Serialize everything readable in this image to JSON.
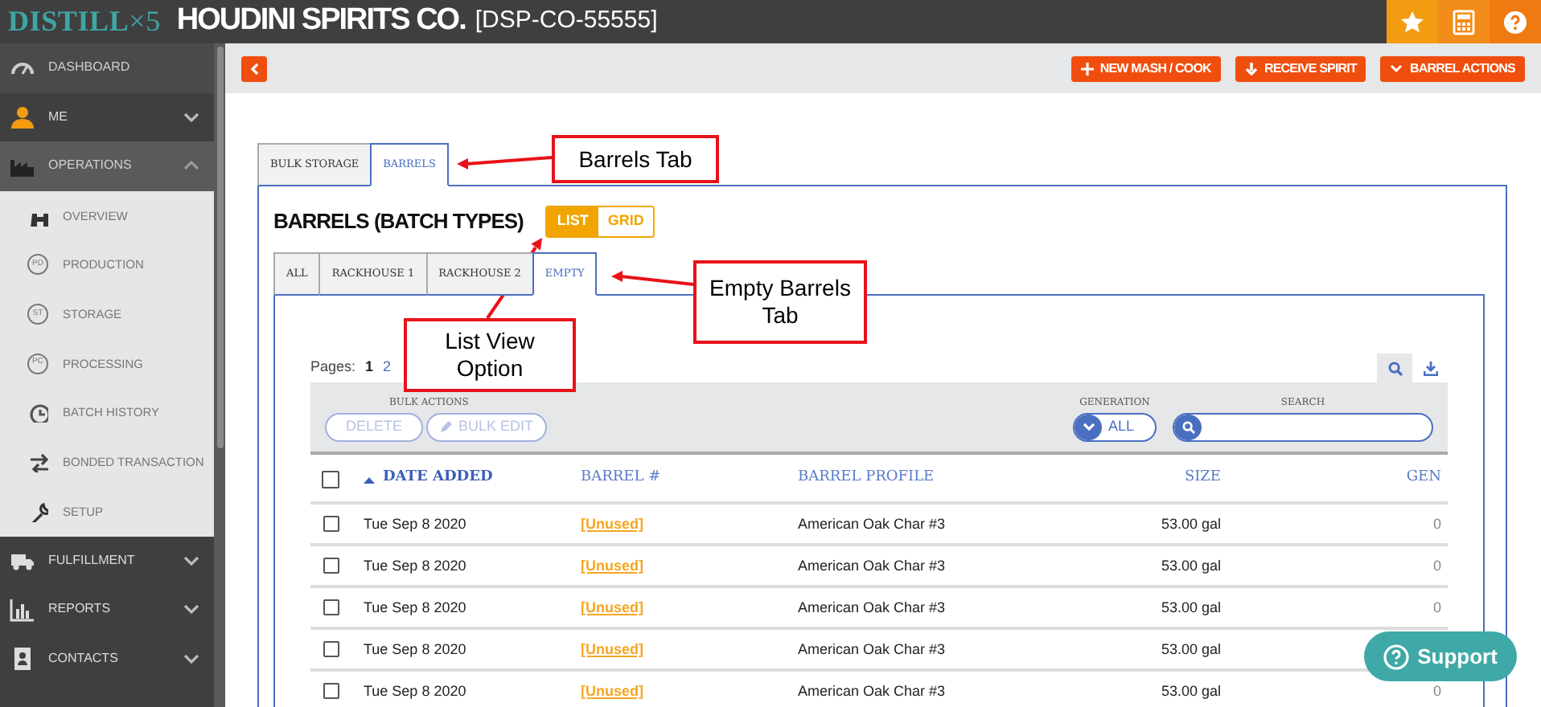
{
  "header": {
    "logo": "DISTILL",
    "logo_mark": "×5",
    "company": "HOUDINI SPIRITS CO.",
    "license": "[DSP-CO-55555]"
  },
  "sidebar": {
    "items": [
      {
        "label": "DASHBOARD",
        "kind": "link",
        "selected": false
      },
      {
        "label": "ME",
        "kind": "section",
        "selected": false,
        "expanded": false
      },
      {
        "label": "OPERATIONS",
        "kind": "section",
        "selected": true,
        "expanded": true,
        "children": [
          {
            "label": "OVERVIEW"
          },
          {
            "label": "PRODUCTION",
            "badge": "PD"
          },
          {
            "label": "STORAGE",
            "badge": "ST"
          },
          {
            "label": "PROCESSING",
            "badge": "PC"
          },
          {
            "label": "BATCH HISTORY"
          },
          {
            "label": "BONDED TRANSACTION"
          },
          {
            "label": "SETUP"
          }
        ]
      },
      {
        "label": "FULFILLMENT",
        "kind": "section",
        "selected": false,
        "expanded": false
      },
      {
        "label": "REPORTS",
        "kind": "section",
        "selected": false,
        "expanded": false
      },
      {
        "label": "CONTACTS",
        "kind": "section",
        "selected": false,
        "expanded": false
      }
    ]
  },
  "toolbar": {
    "buttons": [
      {
        "label": "NEW MASH / COOK",
        "kind": "plus"
      },
      {
        "label": "RECEIVE SPIRIT",
        "kind": "down"
      },
      {
        "label": "BARREL ACTIONS",
        "kind": "caret"
      }
    ]
  },
  "outer_tabs": [
    {
      "label": "BULK STORAGE",
      "selected": false
    },
    {
      "label": "BARRELS",
      "selected": true
    }
  ],
  "section_title": "BARRELS (BATCH TYPES)",
  "view_toggle": [
    {
      "label": "LIST",
      "selected": true
    },
    {
      "label": "GRID",
      "selected": false
    }
  ],
  "inner_tabs": [
    {
      "label": "ALL",
      "selected": false
    },
    {
      "label": "RACKHOUSE 1",
      "selected": false
    },
    {
      "label": "RACKHOUSE 2",
      "selected": false
    },
    {
      "label": "EMPTY",
      "selected": true
    }
  ],
  "pagination": {
    "label": "Pages:",
    "pages": [
      {
        "label": "1",
        "selected": true
      },
      {
        "label": "2",
        "selected": false
      }
    ]
  },
  "bulk_actions": {
    "label": "BULK ACTIONS",
    "buttons": [
      {
        "label": "DELETE",
        "kind": "plain",
        "disabled": true
      },
      {
        "label": "BULK EDIT",
        "kind": "edit",
        "disabled": true
      }
    ]
  },
  "generation": {
    "label": "GENERATION",
    "value": "ALL"
  },
  "search": {
    "label": "SEARCH"
  },
  "table": {
    "select_all": {
      "checked": false
    },
    "columns": [
      {
        "label": "DATE ADDED",
        "sorted": true
      },
      {
        "label": "BARREL #",
        "sorted": false
      },
      {
        "label": "BARREL PROFILE",
        "sorted": false
      },
      {
        "label": "SIZE",
        "sorted": false
      },
      {
        "label": "GEN",
        "sorted": false
      }
    ],
    "rows": [
      {
        "checked": false,
        "date": "Tue Sep 8 2020",
        "barrel": "[Unused]",
        "profile": "American Oak Char #3",
        "size": "53.00 gal",
        "gen": "0"
      },
      {
        "checked": false,
        "date": "Tue Sep 8 2020",
        "barrel": "[Unused]",
        "profile": "American Oak Char #3",
        "size": "53.00 gal",
        "gen": "0"
      },
      {
        "checked": false,
        "date": "Tue Sep 8 2020",
        "barrel": "[Unused]",
        "profile": "American Oak Char #3",
        "size": "53.00 gal",
        "gen": "0"
      },
      {
        "checked": false,
        "date": "Tue Sep 8 2020",
        "barrel": "[Unused]",
        "profile": "American Oak Char #3",
        "size": "53.00 gal"
      },
      {
        "checked": false,
        "date": "Tue Sep 8 2020",
        "barrel": "[Unused]",
        "profile": "American Oak Char #3",
        "size": "53.00 gal",
        "gen": "0"
      }
    ]
  },
  "annotations": [
    {
      "text": "Barrels Tab"
    },
    {
      "text": "Empty Barrels Tab"
    },
    {
      "text": "List View Option"
    }
  ],
  "support_button": "Support"
}
